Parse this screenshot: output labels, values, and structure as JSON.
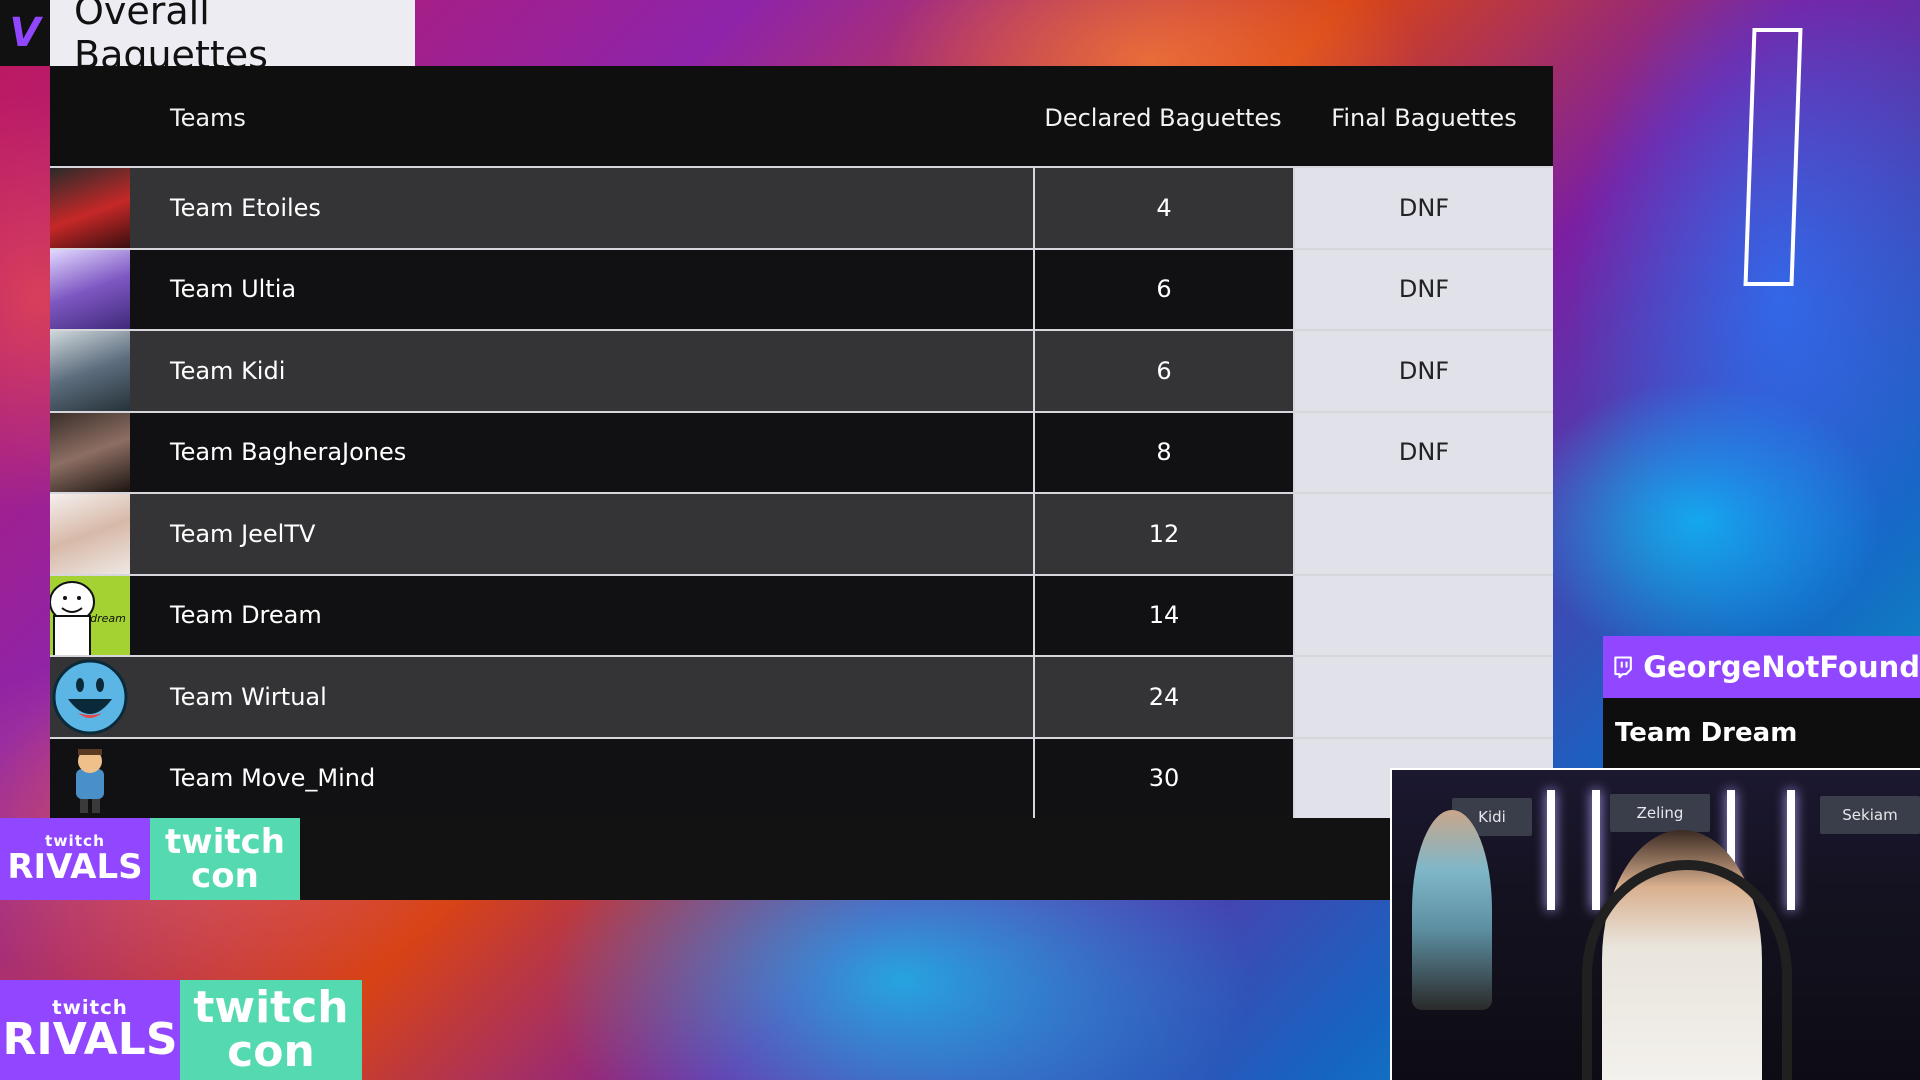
{
  "header": {
    "logo": "V",
    "title": "Overall Baguettes"
  },
  "table": {
    "columns": {
      "teams": "Teams",
      "declared": "Declared Baguettes",
      "final": "Final Baguettes"
    },
    "rows": [
      {
        "team": "Team Etoiles",
        "declared": "4",
        "final": "DNF"
      },
      {
        "team": "Team Ultia",
        "declared": "6",
        "final": "DNF"
      },
      {
        "team": "Team Kidi",
        "declared": "6",
        "final": "DNF"
      },
      {
        "team": "Team BagheraJones",
        "declared": "8",
        "final": "DNF"
      },
      {
        "team": "Team JeelTV",
        "declared": "12",
        "final": ""
      },
      {
        "team": "Team Dream",
        "declared": "14",
        "final": ""
      },
      {
        "team": "Team Wirtual",
        "declared": "24",
        "final": ""
      },
      {
        "team": "Team Move_Mind",
        "declared": "30",
        "final": ""
      }
    ]
  },
  "sponsors": {
    "rivals_top": "twitch",
    "rivals_bottom": "RIVALS",
    "con_top": "twitch",
    "con_bottom": "con"
  },
  "streamer": {
    "name": "GeorgeNotFound",
    "team": "Team Dream"
  },
  "camera": {
    "plates": [
      "Kidi",
      "Zeling",
      "Sekiam"
    ]
  },
  "colors": {
    "twitch_purple": "#9146ff",
    "twitchcon_green": "#55d9b0",
    "table_dark": "#111113",
    "table_light": "#343436",
    "final_cell": "#e1e1ea"
  }
}
